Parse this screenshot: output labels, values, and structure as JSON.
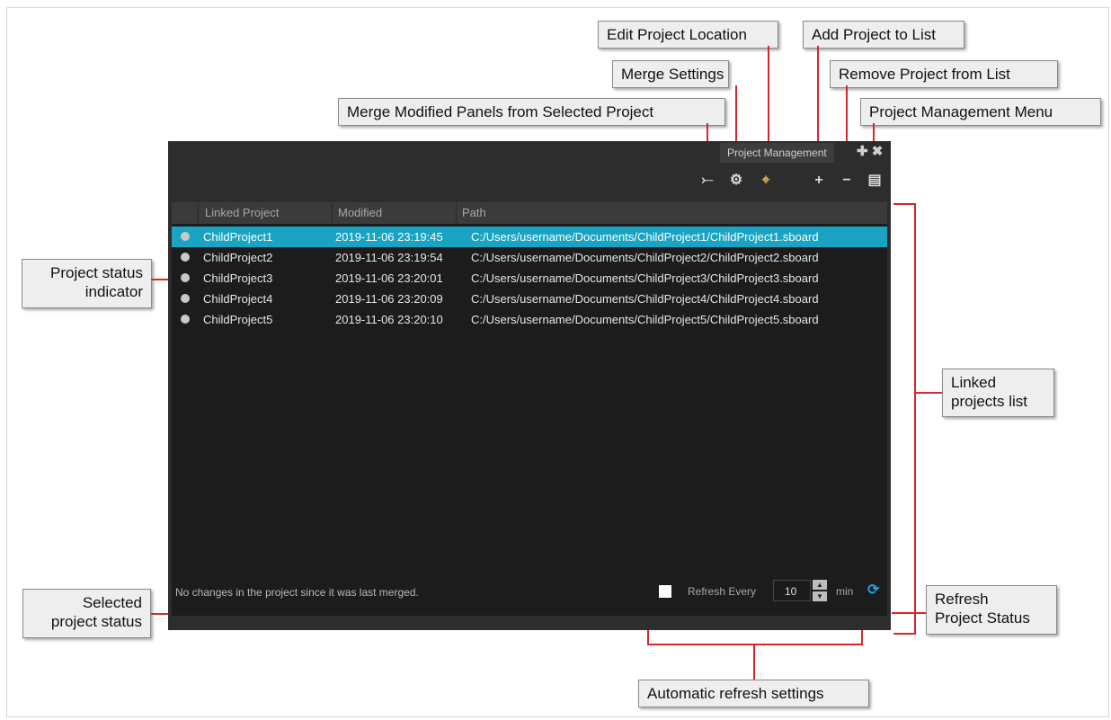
{
  "callouts": {
    "edit_location": "Edit Project Location",
    "add_project": "Add Project to List",
    "merge_settings": "Merge Settings",
    "remove_project": "Remove Project from List",
    "merge_modified": "Merge Modified Panels from Selected Project",
    "menu": "Project Management Menu",
    "status_indicator_1": "Project status",
    "status_indicator_2": "indicator",
    "linked_list_1": "Linked",
    "linked_list_2": "projects list",
    "selected_status_1": "Selected",
    "selected_status_2": "project status",
    "refresh_status_1": "Refresh",
    "refresh_status_2": "Project Status",
    "auto_refresh": "Automatic refresh settings"
  },
  "panel": {
    "tab_title": "Project Management",
    "tab_icons": "✚ ✖",
    "tools": {
      "merge_modified": "⤚",
      "settings": "⚙",
      "edit_location": "⌖",
      "add": "+",
      "remove": "−",
      "menu": "▤"
    },
    "columns": [
      "Linked Project",
      "Modified",
      "Path"
    ],
    "rows": [
      {
        "name": "ChildProject1",
        "modified": "2019-11-06 23:19:45",
        "path": "C:/Users/username/Documents/ChildProject1/ChildProject1.sboard",
        "selected": true
      },
      {
        "name": "ChildProject2",
        "modified": "2019-11-06 23:19:54",
        "path": "C:/Users/username/Documents/ChildProject2/ChildProject2.sboard",
        "selected": false
      },
      {
        "name": "ChildProject3",
        "modified": "2019-11-06 23:20:01",
        "path": "C:/Users/username/Documents/ChildProject3/ChildProject3.sboard",
        "selected": false
      },
      {
        "name": "ChildProject4",
        "modified": "2019-11-06 23:20:09",
        "path": "C:/Users/username/Documents/ChildProject4/ChildProject4.sboard",
        "selected": false
      },
      {
        "name": "ChildProject5",
        "modified": "2019-11-06 23:20:10",
        "path": "C:/Users/username/Documents/ChildProject5/ChildProject5.sboard",
        "selected": false
      }
    ],
    "status_text": "No changes in the project since it was last merged.",
    "refresh_label": "Refresh Every",
    "refresh_value": "10",
    "refresh_unit": "min",
    "refresh_icon": "⟳"
  },
  "colors": {
    "callout_line": "#d7262d",
    "selection": "#1aa3c2",
    "panel_bg": "#2d2d2d",
    "list_bg": "#1c1c1c"
  }
}
